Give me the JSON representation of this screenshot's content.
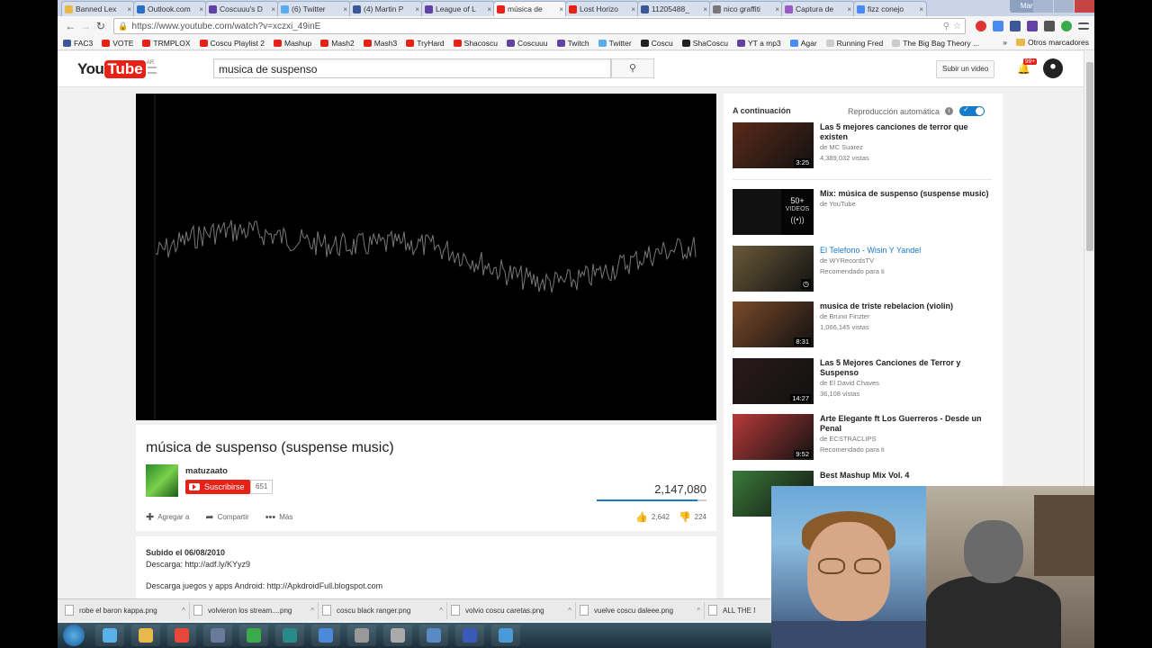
{
  "browser": {
    "tabs": [
      {
        "title": "Banned Lex",
        "color": "#e8b94a",
        "active": false
      },
      {
        "title": "Outlook.com",
        "color": "#2a6fc4",
        "active": false
      },
      {
        "title": "Coscuuu's D",
        "color": "#6441a5",
        "active": false
      },
      {
        "title": "(6) Twitter",
        "color": "#55acee",
        "active": false
      },
      {
        "title": "(4) Martin P",
        "color": "#3b5998",
        "active": false
      },
      {
        "title": "League of L",
        "color": "#6441a5",
        "active": false
      },
      {
        "title": "música de",
        "color": "#e62117",
        "active": true
      },
      {
        "title": "Lost Horizo",
        "color": "#e62117",
        "active": false
      },
      {
        "title": "11205488_",
        "color": "#3b5998",
        "active": false
      },
      {
        "title": "nico graffiti",
        "color": "#777777",
        "active": false
      },
      {
        "title": "Captura de",
        "color": "#9a5ac4",
        "active": false
      },
      {
        "title": "fizz conejo",
        "color": "#4a8af4",
        "active": false
      }
    ],
    "profile_name": "Martin",
    "url": "https://www.youtube.com/watch?v=xczxi_49inE",
    "bookmarks": [
      {
        "label": "FAC3",
        "color": "#3b5998"
      },
      {
        "label": "VOTE",
        "color": "#e62117"
      },
      {
        "label": "TRMPLOX",
        "color": "#e62117"
      },
      {
        "label": "Coscu Playlist 2",
        "color": "#e62117"
      },
      {
        "label": "Mashup",
        "color": "#e62117"
      },
      {
        "label": "Mash2",
        "color": "#e62117"
      },
      {
        "label": "Mash3",
        "color": "#e62117"
      },
      {
        "label": "TryHard",
        "color": "#e62117"
      },
      {
        "label": "Shacoscu",
        "color": "#e62117"
      },
      {
        "label": "Coscuuu",
        "color": "#6441a5"
      },
      {
        "label": "Twitch",
        "color": "#6441a5"
      },
      {
        "label": "Twitter",
        "color": "#55acee"
      },
      {
        "label": "Coscu",
        "color": "#222222"
      },
      {
        "label": "ShaCoscu",
        "color": "#222222"
      },
      {
        "label": "YT a mp3",
        "color": "#6441a5"
      },
      {
        "label": "Agar",
        "color": "#4a8af4"
      },
      {
        "label": "Running Fred",
        "color": "#cccccc"
      },
      {
        "label": "The Big Bag Theory ...",
        "color": "#cccccc"
      }
    ],
    "other_bookmarks": "Otros marcadores"
  },
  "youtube": {
    "logo_you": "You",
    "logo_tube": "Tube",
    "region": "AR",
    "search_value": "musica de suspenso",
    "upload_label": "Subir un video",
    "notification_count": "99+",
    "video": {
      "title": "música de suspenso (suspense music)",
      "channel": "matuzaato",
      "subscribe_label": "Suscribirse",
      "subscriber_count": "651",
      "views": "2,147,080",
      "like_ratio": 0.92,
      "add_label": "Agregar a",
      "share_label": "Compartir",
      "more_label": "Más",
      "likes": "2,642",
      "dislikes": "224"
    },
    "description": {
      "uploaded": "Subido el 06/08/2010",
      "line1": "Descarga: http://adf.ly/KYyz9",
      "line2": "Descarga juegos y apps Android: http://ApkdroidFull.blogspot.com"
    },
    "sidebar": {
      "up_next": "A continuación",
      "autoplay": "Reproducción automática",
      "videos": [
        {
          "title": "Las 5 mejores canciones de terror que existen",
          "channel": "de MC Suarez",
          "meta": "4,389,032 vistas",
          "duration": "3:25",
          "thumb": "#5a2a1a"
        },
        {
          "title": "Mix: música de suspenso (suspense music)",
          "channel": "de YouTube",
          "meta": "",
          "duration": "",
          "thumb": "#111111",
          "mix_count": "50+",
          "mix_label": "VIDEOS"
        },
        {
          "title": "El Telefono - Wisin Y Yandel",
          "channel": "de WYRecordsTV",
          "meta": "Recomendado para ti",
          "duration": "",
          "thumb": "#6a5a3a"
        },
        {
          "title": "musica de triste rebelacion (violin)",
          "channel": "de Bruno Finzter",
          "meta": "1,066,145 vistas",
          "duration": "8:31",
          "thumb": "#7a4a2a"
        },
        {
          "title": "Las 5 Mejores Canciones de Terror y Suspenso",
          "channel": "de El David Chaves",
          "meta": "36,108 vistas",
          "duration": "14:27",
          "thumb": "#2a1a1a"
        },
        {
          "title": "Arte Elegante ft Los Guerreros - Desde un Penal",
          "channel": "de ECSTRACLIPS",
          "meta": "Recomendado para ti",
          "duration": "9:52",
          "thumb": "#b83a3a"
        },
        {
          "title": "Best Mashup Mix Vol. 4",
          "channel": "",
          "meta": "",
          "duration": "",
          "thumb": "#3a7a3a"
        }
      ]
    }
  },
  "downloads": [
    {
      "name": "robe el baron kappa.png"
    },
    {
      "name": "volvieron los stream....png"
    },
    {
      "name": "coscu black ranger.png"
    },
    {
      "name": "volvio coscu caretas.png"
    },
    {
      "name": "vuelve coscu daleee.png"
    },
    {
      "name": "ALL THE NAIT"
    }
  ],
  "taskbar_apps": [
    "#5ab0e8",
    "#e8b94a",
    "#e8483a",
    "#6a7a9a",
    "#3aaa4a",
    "#2a8a8a",
    "#4a8ad8",
    "#999999",
    "#aaaaaa",
    "#5a8ac4",
    "#3a5ab8",
    "#4a9ad8"
  ]
}
